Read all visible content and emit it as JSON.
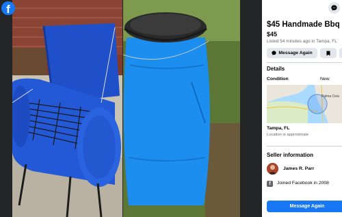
{
  "brand": {
    "logo_letter": "f",
    "color": "#1877f2"
  },
  "photos": [
    {
      "subject": "blue barrel smoker grill, open lid"
    },
    {
      "subject": "blue plastic drum barrel"
    }
  ],
  "icons": {
    "messenger": "messenger-icon",
    "message": "messenger-bubble-icon",
    "save": "bookmark-icon",
    "joined": "facebook-square-icon"
  },
  "listing": {
    "title": "$45 Handmade Bbq",
    "price": "$45",
    "listed": "Listed 54 minutes ago in Tampa, FL"
  },
  "actions": {
    "message_label": "Message Again"
  },
  "details": {
    "heading": "Details",
    "condition_label": "Condition",
    "condition_value": "New",
    "map_town": "Palma Ceia",
    "location": "Tampa, FL",
    "location_note": "Location is approximate"
  },
  "seller": {
    "heading": "Seller information",
    "name": "James R. Parr",
    "joined": "Joined Facebook in 2008"
  },
  "footer": {
    "message_label": "Message Again"
  },
  "colors": {
    "accent": "#1877f2",
    "button_gray": "#e4e6eb",
    "muted_text": "#65676b"
  }
}
